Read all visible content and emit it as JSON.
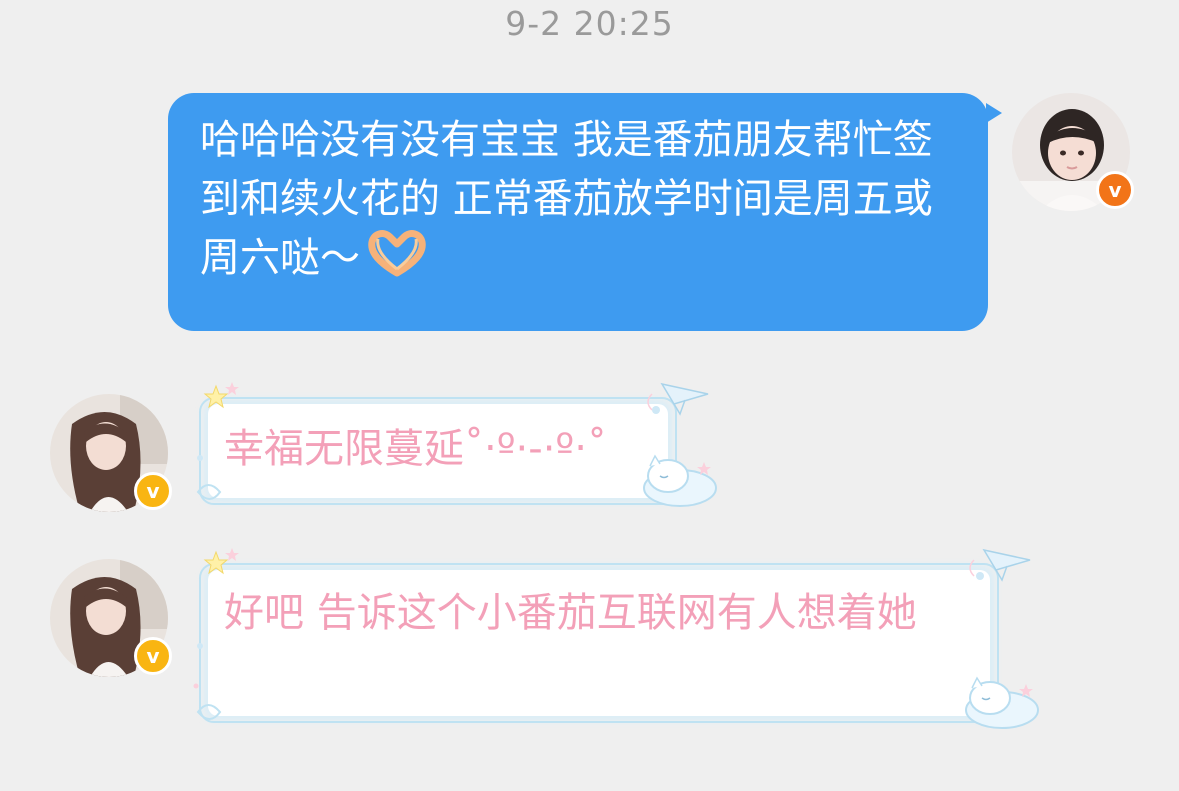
{
  "conversation": {
    "timestamp": "9-2 20:25",
    "messages": [
      {
        "direction": "outgoing",
        "text": "哈哈哈没有没有宝宝 我是番茄朋友帮忙签到和续火花的 正常番茄放学时间是周五或周六哒～",
        "emoji": "heart-hands-icon",
        "bubble_color": "#3e9bf0",
        "badge_color": "#f27418"
      },
      {
        "direction": "incoming",
        "text": "幸福无限蔓延˚‧º·-·º‧˚",
        "badge_color": "#f9b512"
      },
      {
        "direction": "incoming",
        "text": "好吧 告诉这个小番茄互联网有人想着她",
        "badge_color": "#f9b512"
      }
    ]
  },
  "colors": {
    "background": "#efefef",
    "incoming_text": "#f3a0b8",
    "timestamp": "#9a9a9a"
  }
}
